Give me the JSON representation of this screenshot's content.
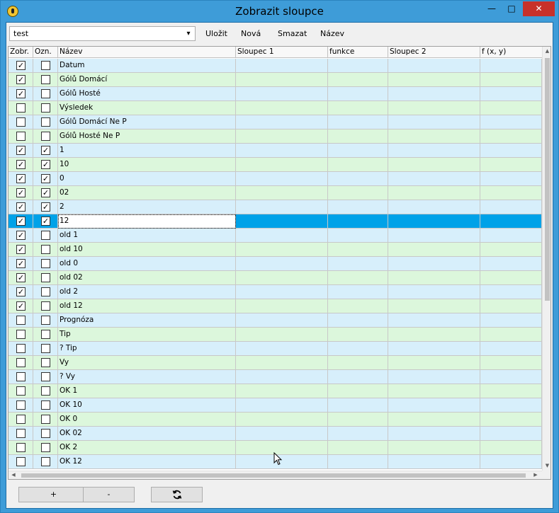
{
  "window": {
    "title": "Zobrazit sloupce",
    "minimize": "—",
    "maximize": "□",
    "close": "✕"
  },
  "toolbar": {
    "combo_value": "test",
    "save_label": "Uložit",
    "new_label": "Nová",
    "delete_label": "Smazat",
    "name_label": "Název"
  },
  "grid": {
    "headers": [
      "Zobr.",
      "Ozn.",
      "Název",
      "Sloupec 1",
      "funkce",
      "Sloupec 2",
      "f (x, y)"
    ],
    "rows": [
      {
        "zobr": true,
        "ozn": false,
        "name": "Datum",
        "color": "blue"
      },
      {
        "zobr": true,
        "ozn": false,
        "name": "Gólů Domácí",
        "color": "green"
      },
      {
        "zobr": true,
        "ozn": false,
        "name": "Gólů Hosté",
        "color": "blue"
      },
      {
        "zobr": false,
        "ozn": false,
        "name": "Výsledek",
        "color": "green"
      },
      {
        "zobr": false,
        "ozn": false,
        "name": "Gólů Domácí Ne P",
        "color": "blue"
      },
      {
        "zobr": false,
        "ozn": false,
        "name": "Gólů Hosté Ne P",
        "color": "green"
      },
      {
        "zobr": true,
        "ozn": true,
        "name": "1",
        "color": "blue"
      },
      {
        "zobr": true,
        "ozn": true,
        "name": "10",
        "color": "green"
      },
      {
        "zobr": true,
        "ozn": true,
        "name": "0",
        "color": "blue"
      },
      {
        "zobr": true,
        "ozn": true,
        "name": "02",
        "color": "green"
      },
      {
        "zobr": true,
        "ozn": true,
        "name": "2",
        "color": "blue"
      },
      {
        "zobr": true,
        "ozn": true,
        "name": "12",
        "color": "sel"
      },
      {
        "zobr": true,
        "ozn": false,
        "name": "old 1",
        "color": "blue"
      },
      {
        "zobr": true,
        "ozn": false,
        "name": "old 10",
        "color": "green"
      },
      {
        "zobr": true,
        "ozn": false,
        "name": "old 0",
        "color": "blue"
      },
      {
        "zobr": true,
        "ozn": false,
        "name": "old 02",
        "color": "green"
      },
      {
        "zobr": true,
        "ozn": false,
        "name": "old 2",
        "color": "blue"
      },
      {
        "zobr": true,
        "ozn": false,
        "name": "old 12",
        "color": "green"
      },
      {
        "zobr": false,
        "ozn": false,
        "name": "Prognóza",
        "color": "blue"
      },
      {
        "zobr": false,
        "ozn": false,
        "name": "Tip",
        "color": "green"
      },
      {
        "zobr": false,
        "ozn": false,
        "name": "? Tip",
        "color": "blue"
      },
      {
        "zobr": false,
        "ozn": false,
        "name": "Vy",
        "color": "green"
      },
      {
        "zobr": false,
        "ozn": false,
        "name": "? Vy",
        "color": "blue"
      },
      {
        "zobr": false,
        "ozn": false,
        "name": "OK 1",
        "color": "green"
      },
      {
        "zobr": false,
        "ozn": false,
        "name": "OK 10",
        "color": "blue"
      },
      {
        "zobr": false,
        "ozn": false,
        "name": "OK 0",
        "color": "green"
      },
      {
        "zobr": false,
        "ozn": false,
        "name": "OK 02",
        "color": "blue"
      },
      {
        "zobr": false,
        "ozn": false,
        "name": "OK 2",
        "color": "green"
      },
      {
        "zobr": false,
        "ozn": false,
        "name": "OK 12",
        "color": "blue"
      }
    ]
  },
  "bottom": {
    "add_label": "+",
    "remove_label": "-",
    "refresh_icon": "refresh-icon"
  },
  "colors": {
    "row_blue": "#d7effb",
    "row_green": "#dcf7dc",
    "selected": "#00a2e8",
    "close": "#c7312a"
  }
}
